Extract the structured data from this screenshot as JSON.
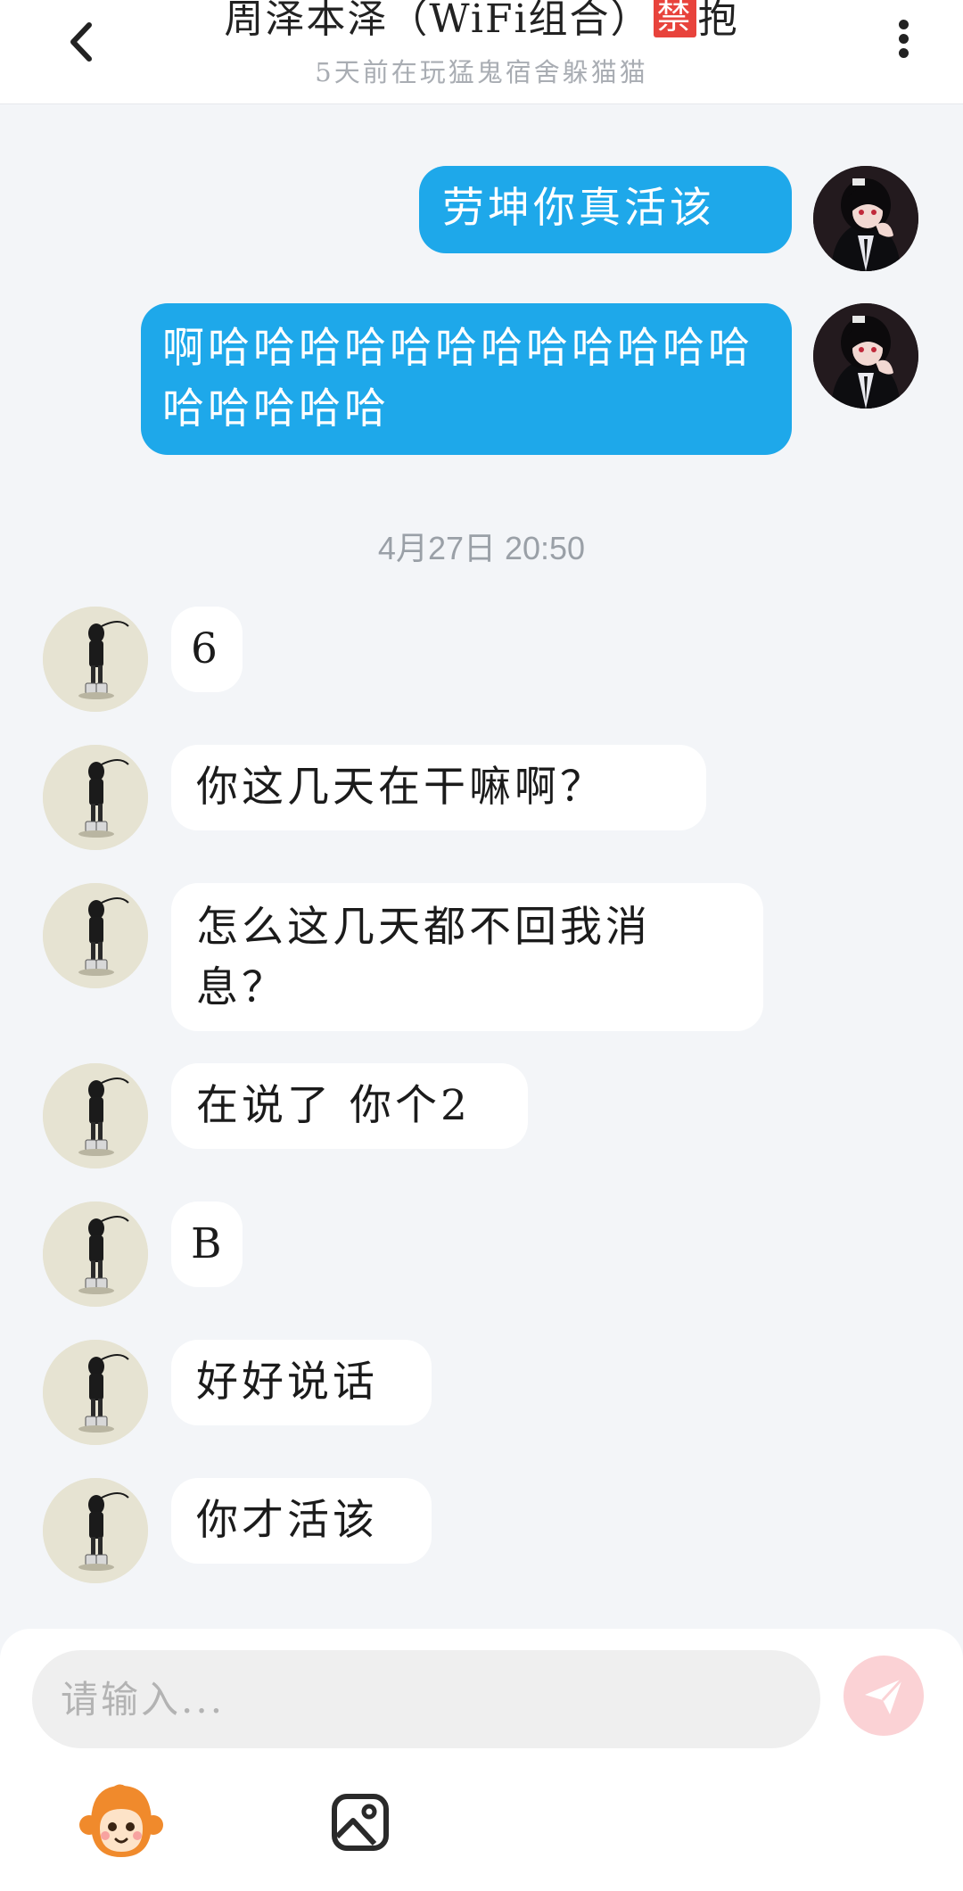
{
  "header": {
    "title_pre": "周泽本泽（WiFi组合）",
    "ban_badge": "禁",
    "title_post": "抱",
    "subtitle": "5天前在玩猛鬼宿舍躲猫猫"
  },
  "messages_sent": [
    {
      "text": "劳坤你真活该"
    },
    {
      "text": "啊哈哈哈哈哈哈哈哈哈哈哈哈哈哈哈哈哈"
    }
  ],
  "timestamp": "4月27日  20:50",
  "messages_received": [
    {
      "text": "6"
    },
    {
      "text": "你这几天在干嘛啊？"
    },
    {
      "text": "怎么这几天都不回我消息？"
    },
    {
      "text": "在说了 你个2"
    },
    {
      "text": "B"
    },
    {
      "text": "好好说话"
    },
    {
      "text": "你才活该"
    }
  ],
  "input": {
    "placeholder": "请输入..."
  },
  "icons": {
    "back": "chevron-left-icon",
    "more": "vertical-dots-icon",
    "send": "paper-plane-icon",
    "emoji": "monkey-face-icon",
    "image": "image-icon"
  },
  "colors": {
    "sent_bubble": "#1ea8ea",
    "received_bubble": "#ffffff",
    "background": "#f3f5f8",
    "ban_badge": "#e8433c",
    "send_button": "#fbd2d5"
  }
}
